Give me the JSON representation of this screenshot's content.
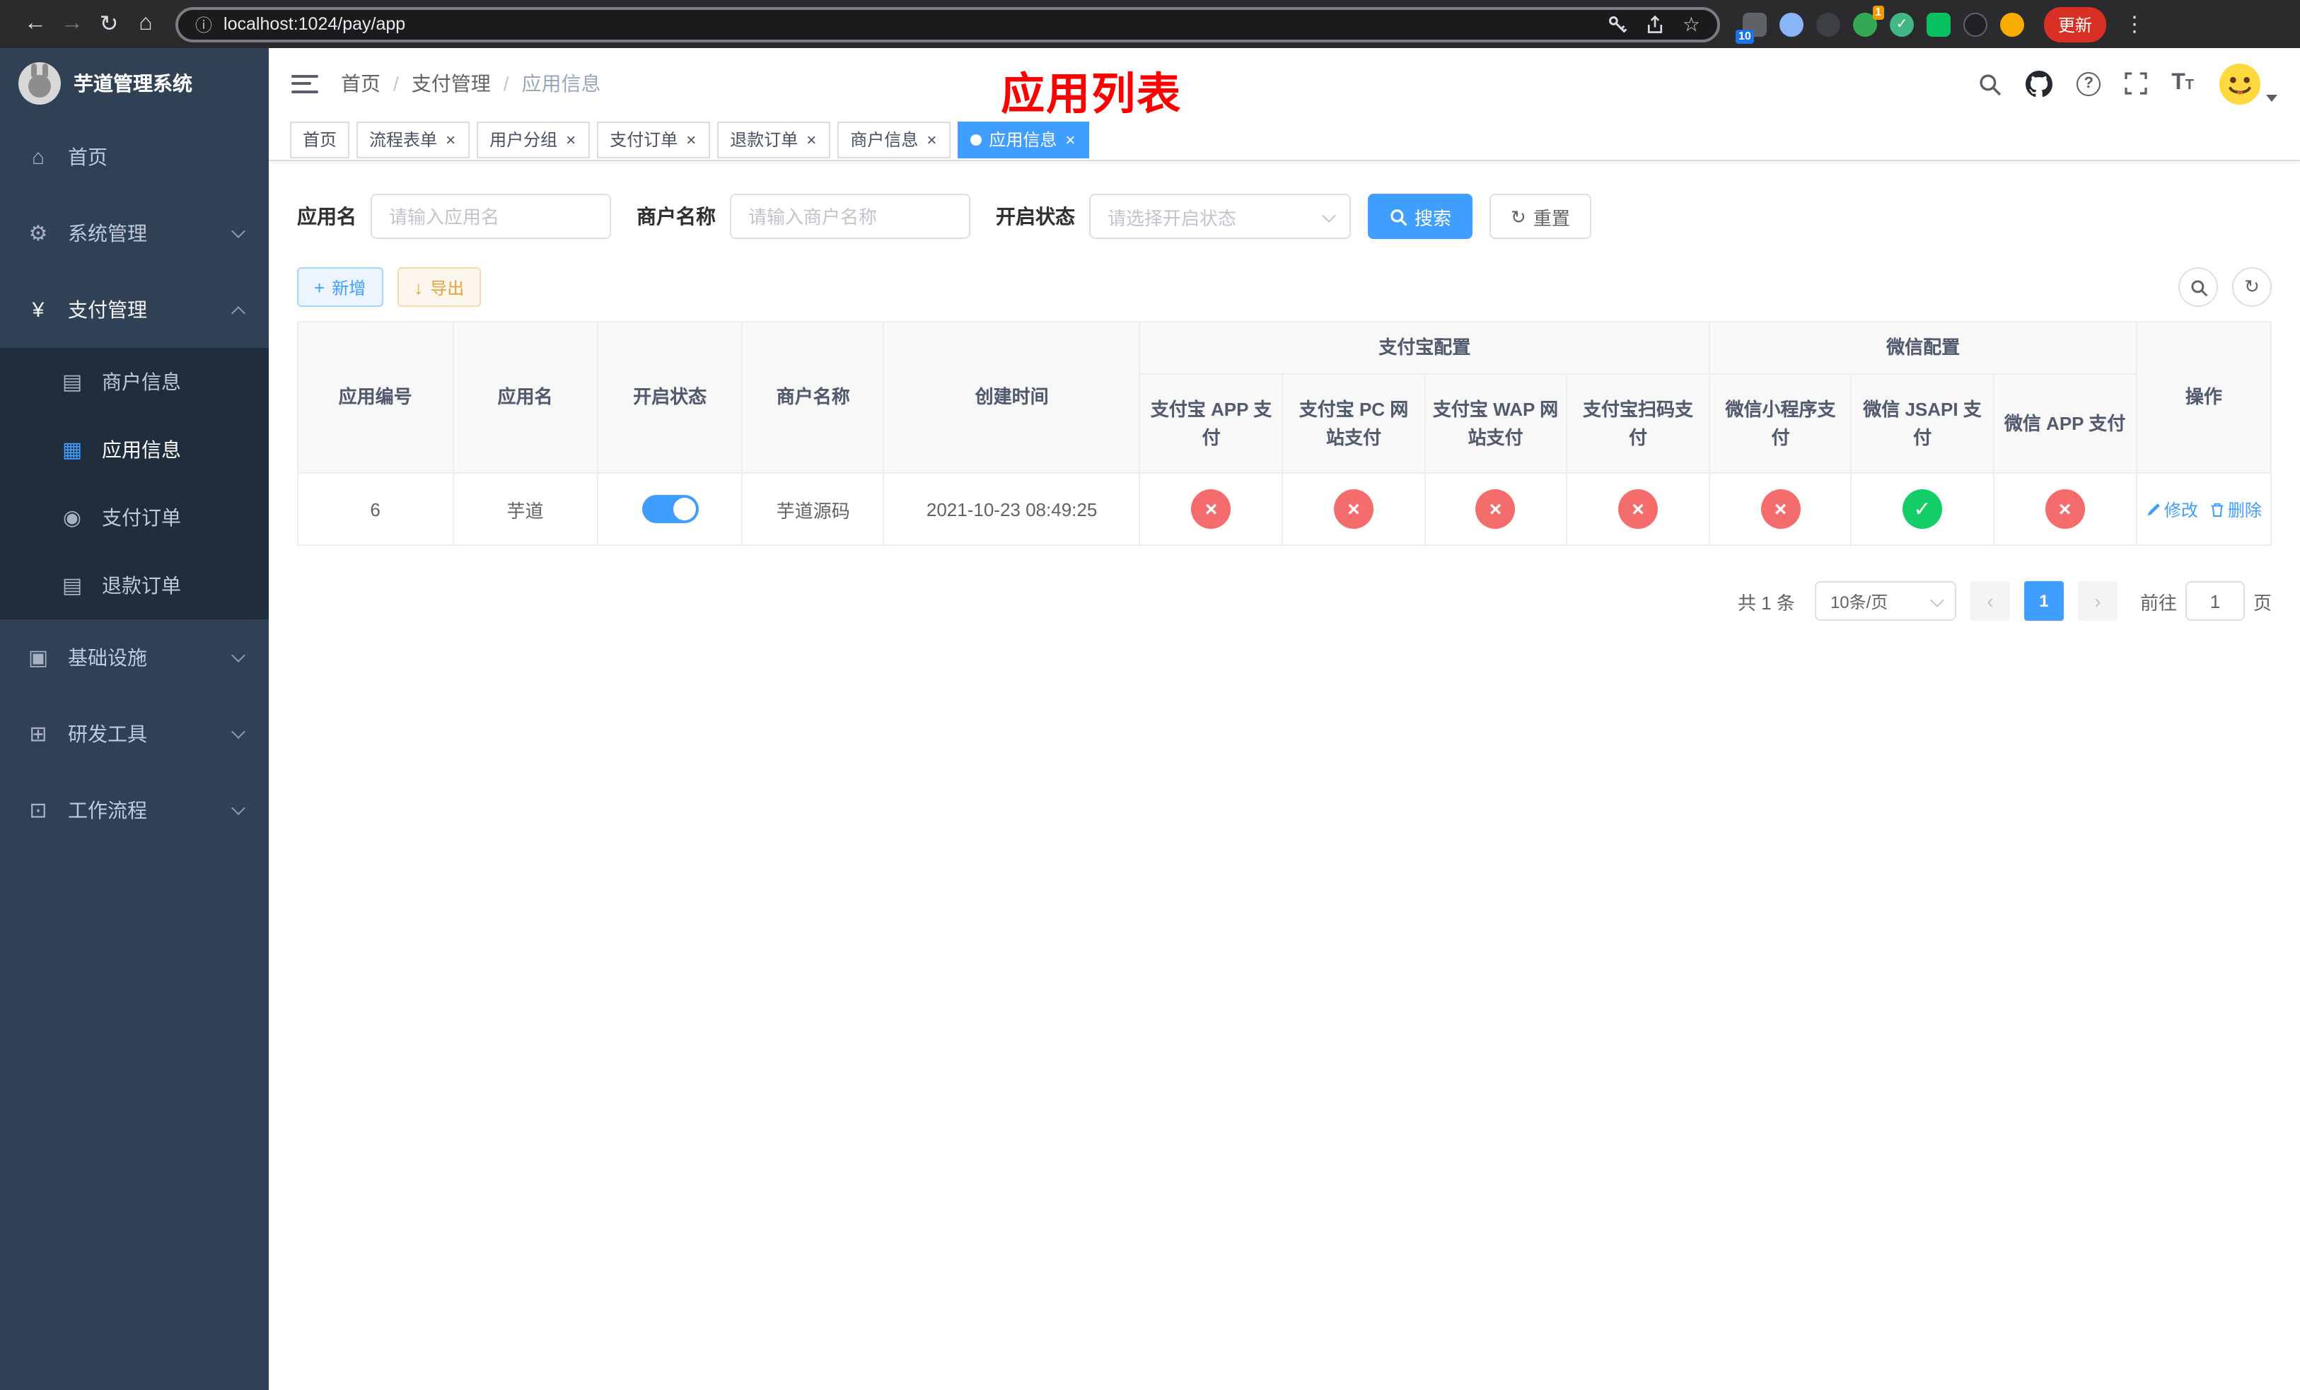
{
  "colors": {
    "accent": "#409eff",
    "success": "#13ce66",
    "danger": "#f56c6c",
    "warning": "#e6a23c",
    "title_red": "#ff0000",
    "sidebar_bg": "#304156",
    "submenu_bg": "#1f2d3d"
  },
  "icons": {
    "back": "←",
    "forward": "→",
    "reload": "↻",
    "home": "⌂",
    "info": "ⓘ",
    "star": "☆",
    "menu_dots": "⋮",
    "vue_check": "✓",
    "home_menu": "⌂",
    "gear": "⚙",
    "yen": "¥",
    "card": "▤",
    "grid": "▦",
    "order": "◉",
    "doc": "▤",
    "infra": "▣",
    "tools": "⊞",
    "flow": "⊡",
    "plus": "+",
    "download": "↓",
    "refresh": "↻",
    "check": "✓",
    "cross": "×",
    "close": "×",
    "prev": "‹",
    "next": "›",
    "question": "?",
    "font_big": "T",
    "font_small": "T"
  },
  "browser": {
    "url": "localhost:1024/pay/app",
    "update_button": "更新",
    "ext_badge_grid": "10",
    "ext_badge_green": "1"
  },
  "sidebar": {
    "title": "芋道管理系统",
    "home": "首页",
    "system": "系统管理",
    "payment": "支付管理",
    "merchant": "商户信息",
    "app_info": "应用信息",
    "pay_order": "支付订单",
    "refund_order": "退款订单",
    "infrastructure": "基础设施",
    "dev_tools": "研发工具",
    "workflow": "工作流程"
  },
  "header": {
    "breadcrumb": [
      "首页",
      "支付管理",
      "应用信息"
    ],
    "separator": "/",
    "page_title": "应用列表"
  },
  "tabs": [
    {
      "label": "首页"
    },
    {
      "label": "流程表单"
    },
    {
      "label": "用户分组"
    },
    {
      "label": "支付订单"
    },
    {
      "label": "退款订单"
    },
    {
      "label": "商户信息"
    },
    {
      "label": "应用信息"
    }
  ],
  "filters": {
    "app_name_label": "应用名",
    "app_name_placeholder": "请输入应用名",
    "merchant_label": "商户名称",
    "merchant_placeholder": "请输入商户名称",
    "status_label": "开启状态",
    "status_placeholder": "请选择开启状态",
    "search_button": "搜索",
    "reset_button": "重置"
  },
  "toolbar": {
    "add_button": "新增",
    "export_button": "导出"
  },
  "table": {
    "headers": {
      "app_id": "应用编号",
      "app_name": "应用名",
      "status": "开启状态",
      "merchant_name": "商户名称",
      "create_time": "创建时间",
      "alipay_group": "支付宝配置",
      "wechat_group": "微信配置",
      "alipay_app": "支付宝 APP 支付",
      "alipay_pc": "支付宝 PC 网站支付",
      "alipay_wap": "支付宝 WAP 网站支付",
      "alipay_qr": "支付宝扫码支付",
      "wx_lite": "微信小程序支付",
      "wx_jsapi": "微信 JSAPI 支付",
      "wx_app": "微信 APP 支付",
      "actions": "操作"
    },
    "rows": [
      {
        "app_id": "6",
        "app_name": "芋道",
        "status_on": true,
        "merchant_name": "芋道源码",
        "create_time": "2021-10-23 08:49:25",
        "alipay_app": false,
        "alipay_pc": false,
        "alipay_wap": false,
        "alipay_qr": false,
        "wx_lite": false,
        "wx_jsapi": true,
        "wx_app": false,
        "edit": "修改",
        "delete": "删除"
      }
    ]
  },
  "pagination": {
    "total": "共 1 条",
    "page_size": "10条/页",
    "page": "1",
    "goto_label": "前往",
    "goto_value": "1",
    "unit_label": "页"
  }
}
